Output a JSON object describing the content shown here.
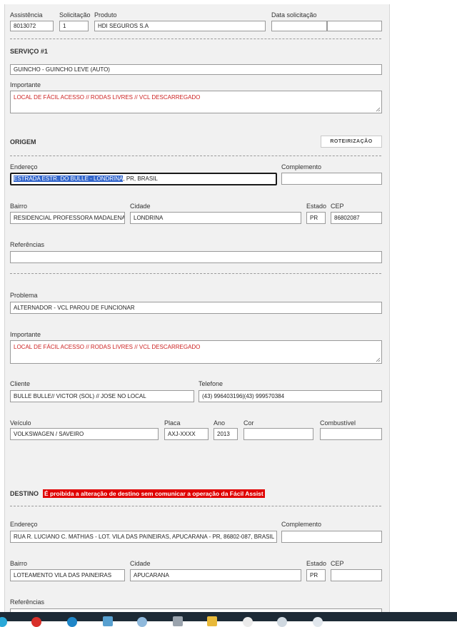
{
  "header": {
    "assistencia_label": "Assistência",
    "assistencia_value": "8013072",
    "solicitacao_label": "Solicitação",
    "solicitacao_value": "1",
    "produto_label": "Produto",
    "produto_value": "HDI SEGUROS S.A",
    "data_label": "Data solicitação",
    "data_value": "",
    "hora_value": ""
  },
  "servico": {
    "title": "SERVIÇO #1",
    "tipo_value": "GUINCHO - GUINCHO LEVE (AUTO)",
    "importante_label": "Importante",
    "importante_value": "LOCAL DE FÁCIL ACESSO // RODAS LIVRES // VCL DESCARREGADO"
  },
  "origem": {
    "title": "ORIGEM",
    "roteirizacao_label": "ROTEIRIZAÇÃO",
    "endereco_label": "Endereço",
    "endereco_selected": "ESTRADA ESTR. DO BULLE - LONDRINA",
    "endereco_rest": ", PR, BRASIL",
    "complemento_label": "Complemento",
    "complemento_value": "",
    "bairro_label": "Bairro",
    "bairro_value": "RESIDENCIAL PROFESSORA MADALENA CA",
    "cidade_label": "Cidade",
    "cidade_value": "LONDRINA",
    "estado_label": "Estado",
    "estado_value": "PR",
    "cep_label": "CEP",
    "cep_value": "86802087",
    "referencias_label": "Referências",
    "referencias_value": ""
  },
  "problema": {
    "problema_label": "Problema",
    "problema_value": "ALTERNADOR - VCL PAROU DE FUNCIONAR",
    "importante_label": "Importante",
    "importante_value": "LOCAL DE FÁCIL ACESSO // RODAS LIVRES // VCL DESCARREGADO",
    "cliente_label": "Cliente",
    "cliente_value": "BULLE BULLE// VICTOR (SOL) // JOSE NO LOCAL",
    "telefone_label": "Telefone",
    "telefone_value": "(43) 996403196|(43) 999570384",
    "veiculo_label": "Veículo",
    "veiculo_value": "VOLKSWAGEN / SAVEIRO",
    "placa_label": "Placa",
    "placa_value": "AXJ-XXXX",
    "ano_label": "Ano",
    "ano_value": "2013",
    "cor_label": "Cor",
    "cor_value": "",
    "combustivel_label": "Combustível",
    "combustivel_value": ""
  },
  "destino": {
    "title": "DESTINO",
    "warning": "É proibida a alteração de destino sem comunicar a operação da Fácil Assist",
    "endereco_label": "Endereço",
    "endereco_value": "RUA R. LUCIANO C. MATHIAS - LOT. VILA DAS PAINEIRAS, APUCARANA - PR, 86802-087, BRASIL",
    "complemento_label": "Complemento",
    "complemento_value": "",
    "bairro_label": "Bairro",
    "bairro_value": "LOTEAMENTO VILA DAS PAINEIRAS",
    "cidade_label": "Cidade",
    "cidade_value": "APUCARANA",
    "estado_label": "Estado",
    "estado_value": "PR",
    "cep_label": "CEP",
    "cep_value": "",
    "referencias_label": "Referências"
  },
  "colors": {
    "warning_bg": "#e00000",
    "important_text": "#cc2222",
    "selection": "#3366cc"
  },
  "taskbar": {
    "icons": [
      "chrome-icon",
      "media-icon",
      "browser-icon",
      "app-icon",
      "folder-icon",
      "files-icon",
      "explorer-icon",
      "chat-icon",
      "app2-icon",
      "app3-icon"
    ]
  }
}
